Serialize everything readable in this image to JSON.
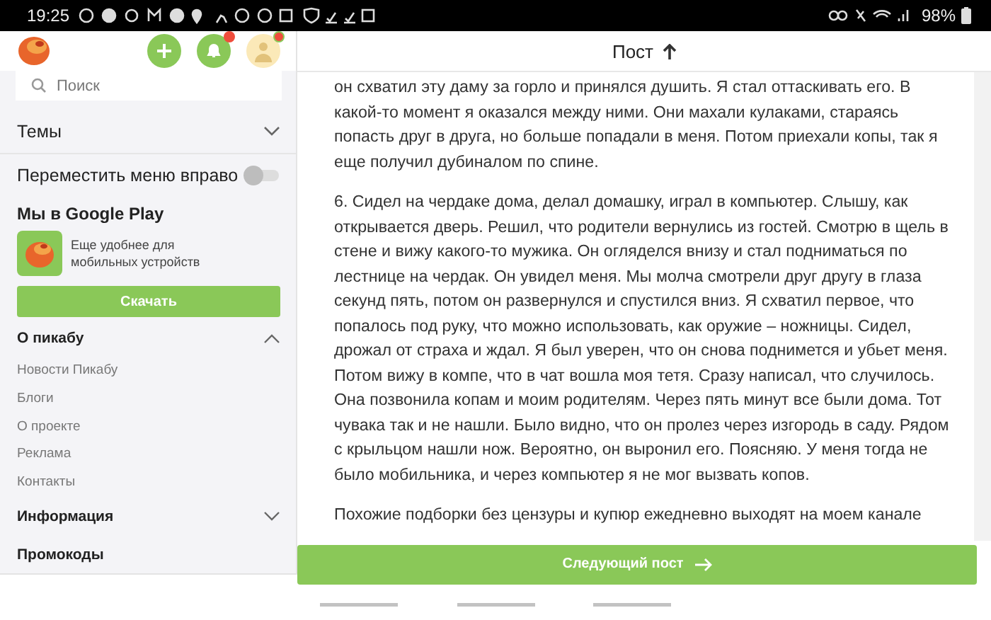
{
  "status_bar": {
    "time": "19:25",
    "battery": "98%"
  },
  "toolbar": {
    "notifications_unread": true,
    "profile_badge": true
  },
  "sidebar": {
    "search": {
      "placeholder": "Поиск"
    },
    "themes": {
      "label": "Темы",
      "expanded": false
    },
    "move_menu": {
      "label": "Переместить меню вправо",
      "on": false
    },
    "google_play": {
      "title": "Мы в Google Play",
      "description": "Еще удобнее для мобильных устройств",
      "button": "Скачать"
    },
    "sections": [
      {
        "label": "О пикабу",
        "expanded": true,
        "items": [
          "Новости Пикабу",
          "Блоги",
          "О проекте",
          "Реклама",
          "Контакты"
        ]
      },
      {
        "label": "Информация",
        "expanded": false
      },
      {
        "label": "Промокоды"
      }
    ]
  },
  "header": {
    "title": "Пост"
  },
  "post": {
    "paragraphs": [
      "он схватил эту даму за горло и принялся душить. Я стал оттаскивать его. В какой-то момент я оказался между ними. Они махали кулаками, стараясь попасть друг в друга, но больше попадали в меня. Потом приехали копы, так я еще получил дубиналом по спине.",
      "6. Сидел на чердаке дома, делал домашку, играл в компьютер. Слышу, как открывается дверь. Решил, что родители вернулись из гостей. Смотрю в щель в стене и вижу какого-то мужика. Он огляделся внизу и стал подниматься по лестнице на чердак. Он увидел меня. Мы молча смотрели друг другу в глаза секунд пять, потом он развернулся и спустился вниз. Я схватил первое, что попалось под руку, что можно использовать, как оружие – ножницы. Сидел, дрожал от страха и ждал. Я был уверен, что он снова поднимется и убьет меня. Потом вижу в компе, что в чат вошла моя тетя. Сразу написал, что случилось. Она позвонила копам и моим родителям. Через пять минут все были дома. Тот чувака так и не нашли. Было видно, что он пролез через изгородь в саду. Рядом с крыльцом нашли нож. Вероятно, он выронил его. Поясняю. У меня тогда не было мобильника, и через компьютер я не мог вызвать копов.",
      "Похожие подборки без цензуры и купюр ежедневно выходят на моем канале"
    ]
  },
  "next_button": "Следующий пост"
}
